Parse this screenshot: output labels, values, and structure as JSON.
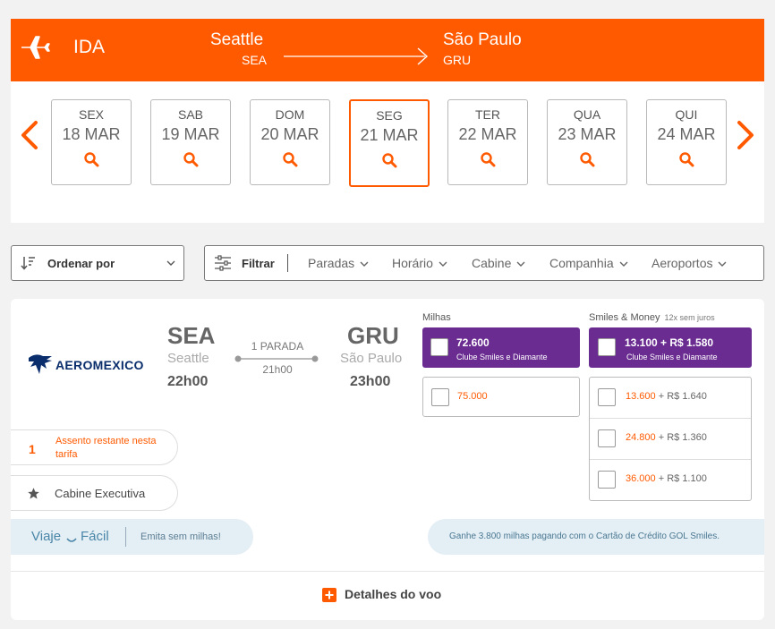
{
  "header": {
    "direction": "IDA",
    "origin": {
      "city": "Seattle",
      "code": "SEA"
    },
    "destination": {
      "city": "São Paulo",
      "code": "GRU"
    },
    "accent_color": "#ff5a00"
  },
  "dates": [
    {
      "dow": "SEX",
      "date": "18 MAR"
    },
    {
      "dow": "SAB",
      "date": "19 MAR"
    },
    {
      "dow": "DOM",
      "date": "20 MAR"
    },
    {
      "dow": "SEG",
      "date": "21 MAR",
      "selected": true
    },
    {
      "dow": "TER",
      "date": "22 MAR"
    },
    {
      "dow": "QUA",
      "date": "23 MAR"
    },
    {
      "dow": "QUI",
      "date": "24 MAR"
    }
  ],
  "toolbar": {
    "sort_label": "Ordenar por",
    "filter_label": "Filtrar",
    "filters": [
      "Paradas",
      "Horário",
      "Cabine",
      "Companhia",
      "Aeroportos"
    ]
  },
  "flight": {
    "airline": "AEROMEXICO",
    "dep": {
      "code": "SEA",
      "city": "Seattle",
      "time": "22h00"
    },
    "arr": {
      "code": "GRU",
      "city": "São Paulo",
      "time": "23h00"
    },
    "stops": "1 PARADA",
    "duration": "21h00",
    "seats": {
      "count": "1",
      "text": "Assento restante nesta tarifa"
    },
    "cabin": "Cabine Executiva",
    "viaje": {
      "brand_a": "Viaje",
      "brand_b": "Fácil",
      "text": "Emita sem milhas!"
    },
    "gol_text": "Ganhe 3.800 milhas pagando com o Cartão de Crédito GOL Smiles.",
    "details_label": "Detalhes do voo"
  },
  "fares": {
    "milhas": {
      "label": "Milhas",
      "club": {
        "value": "72.600",
        "club": "Clube Smiles e Diamante"
      },
      "options": [
        "75.000"
      ]
    },
    "smiles_money": {
      "label": "Smiles & Money",
      "installments": "12x sem juros",
      "club": {
        "value": "13.100 + R$ 1.580",
        "club": "Clube Smiles e Diamante"
      },
      "options": [
        {
          "miles": "13.600",
          "money": "+ R$ 1.640"
        },
        {
          "miles": "24.800",
          "money": "+ R$ 1.360"
        },
        {
          "miles": "36.000",
          "money": "+ R$ 1.100"
        }
      ]
    }
  }
}
